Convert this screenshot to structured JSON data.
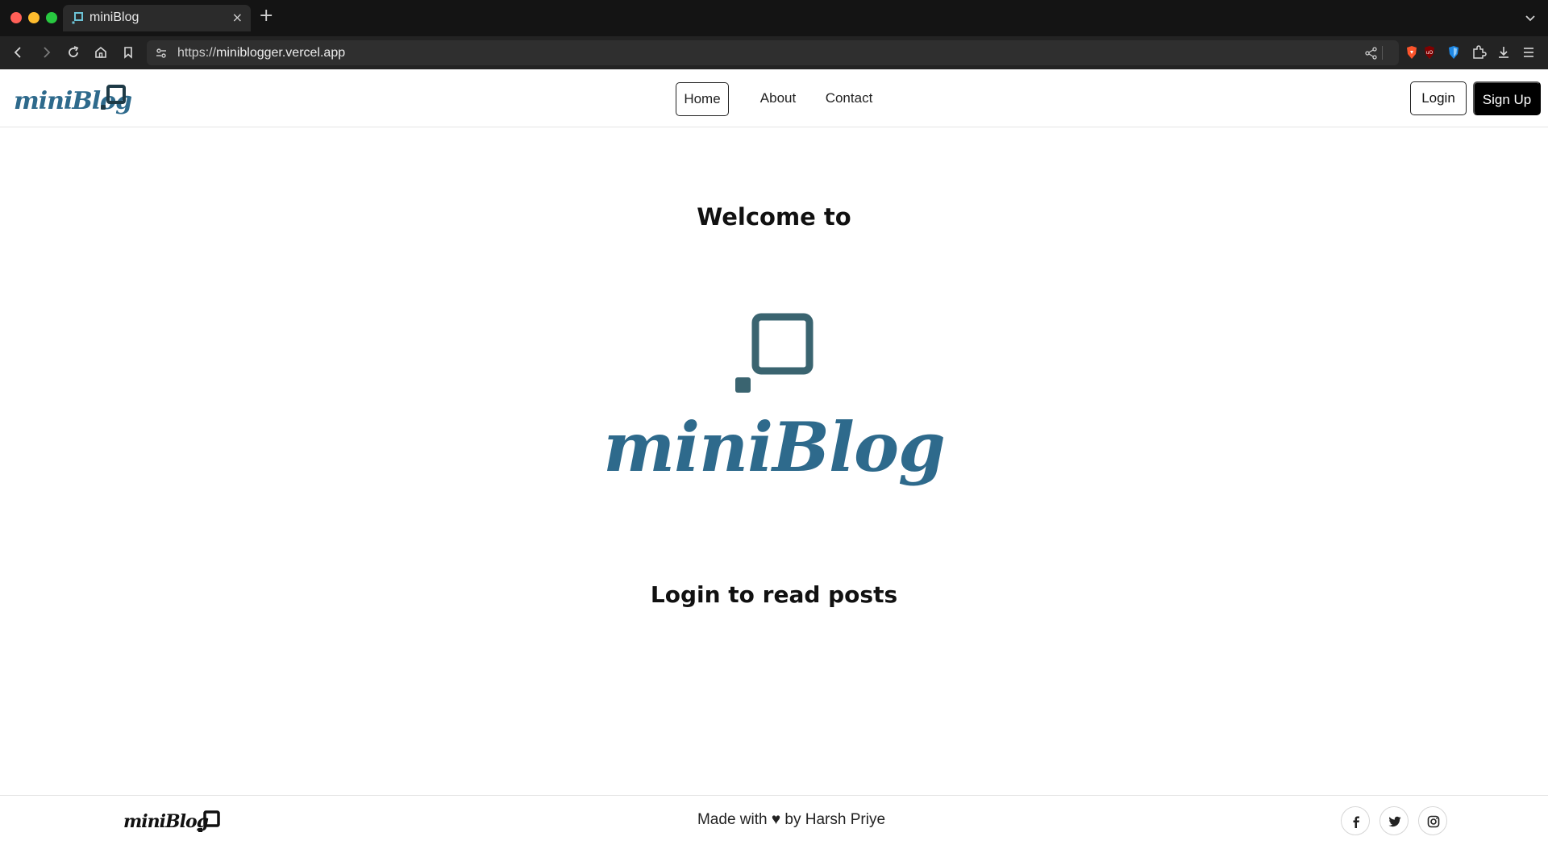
{
  "browser": {
    "tab_title": "miniBlog",
    "new_tab_symbol": "+",
    "close_symbol": "×",
    "url_scheme": "https://",
    "url_host": "miniblogger.vercel.app"
  },
  "header": {
    "brand": "miniBlog",
    "nav": [
      {
        "label": "Home",
        "active": true
      },
      {
        "label": "About",
        "active": false
      },
      {
        "label": "Contact",
        "active": false
      }
    ],
    "login_label": "Login",
    "signup_label": "Sign Up"
  },
  "hero": {
    "welcome": "Welcome to",
    "wordmark": "miniBlog",
    "login_prompt": "Login to read posts"
  },
  "footer": {
    "brand": "miniBlog",
    "credit": "Made with ♥ by Harsh Priye",
    "social": [
      "facebook-icon",
      "twitter-icon",
      "instagram-icon"
    ]
  },
  "colors": {
    "brand": "#2e6a8c",
    "logo_square": "#3a6470",
    "chrome_bg": "#1c1c1c",
    "signup_bg": "#000000"
  }
}
